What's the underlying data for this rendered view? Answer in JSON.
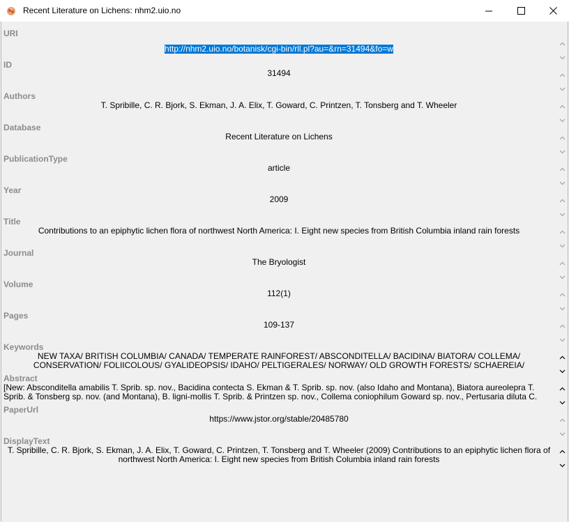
{
  "window": {
    "title": "Recent Literature on Lichens: nhm2.uio.no",
    "minimize_glyph": "—",
    "maximize_glyph": "☐",
    "close_glyph": "✕"
  },
  "fields": [
    {
      "label": "URI",
      "value": "http://nhm2.uio.no/botanisk/cgi-bin/rll.pl?au=&rn=31494&fo=w"
    },
    {
      "label": "ID",
      "value": "31494"
    },
    {
      "label": "Authors",
      "value": "T. Spribille, C. R. Bjork, S. Ekman, J. A. Elix, T. Goward, C. Printzen, T. Tonsberg and T. Wheeler"
    },
    {
      "label": "Database",
      "value": "Recent Literature on Lichens"
    },
    {
      "label": "PublicationType",
      "value": "article"
    },
    {
      "label": "Year",
      "value": "2009"
    },
    {
      "label": "Title",
      "value": "Contributions to an epiphytic lichen flora of northwest North America: I. Eight new species from British Columbia inland rain forests"
    },
    {
      "label": "Journal",
      "value": "The Bryologist"
    },
    {
      "label": "Volume",
      "value": "112(1)"
    },
    {
      "label": "Pages",
      "value": "109-137"
    },
    {
      "label": "Keywords",
      "value": "NEW TAXA/ BRITISH COLUMBIA/ CANADA/ TEMPERATE RAINFOREST/ ABSCONDITELLA/ BACIDINA/ BIATORA/ COLLEMA/ CONSERVATION/ FOLIICOLOUS/ GYALIDEOPSIS/ IDAHO/ PELTIGERALES/ NORWAY/ OLD GROWTH FORESTS/ SCHAEREIA/ SCOLICIOSPORUM/ LOBARIC ACID"
    },
    {
      "label": "Abstract",
      "value": "[New: Absconditella amabilis T. Sprib. sp. nov., Bacidina contecta S. Ekman & T. Sprib. sp. nov. (also Idaho and Montana), Biatora aureolepra T. Sprib. & Tonsberg sp. nov. (and Montana), B. ligni-mollis T. Sprib. & Printzen sp. nov., Collema coniophilum Goward sp. nov., Pertusaria diluta C. Bjork, G. Thor & T. Wheeler sp. nov. (and"
    },
    {
      "label": "PaperUrl",
      "value": "https://www.jstor.org/stable/20485780"
    },
    {
      "label": "DisplayText",
      "value": "T. Spribille, C. R. Bjork, S. Ekman, J. A. Elix, T. Goward, C. Printzen, T. Tonsberg and T. Wheeler (2009) Contributions to an epiphytic lichen flora of northwest North America: I. Eight new species from British Columbia inland rain forests"
    }
  ]
}
